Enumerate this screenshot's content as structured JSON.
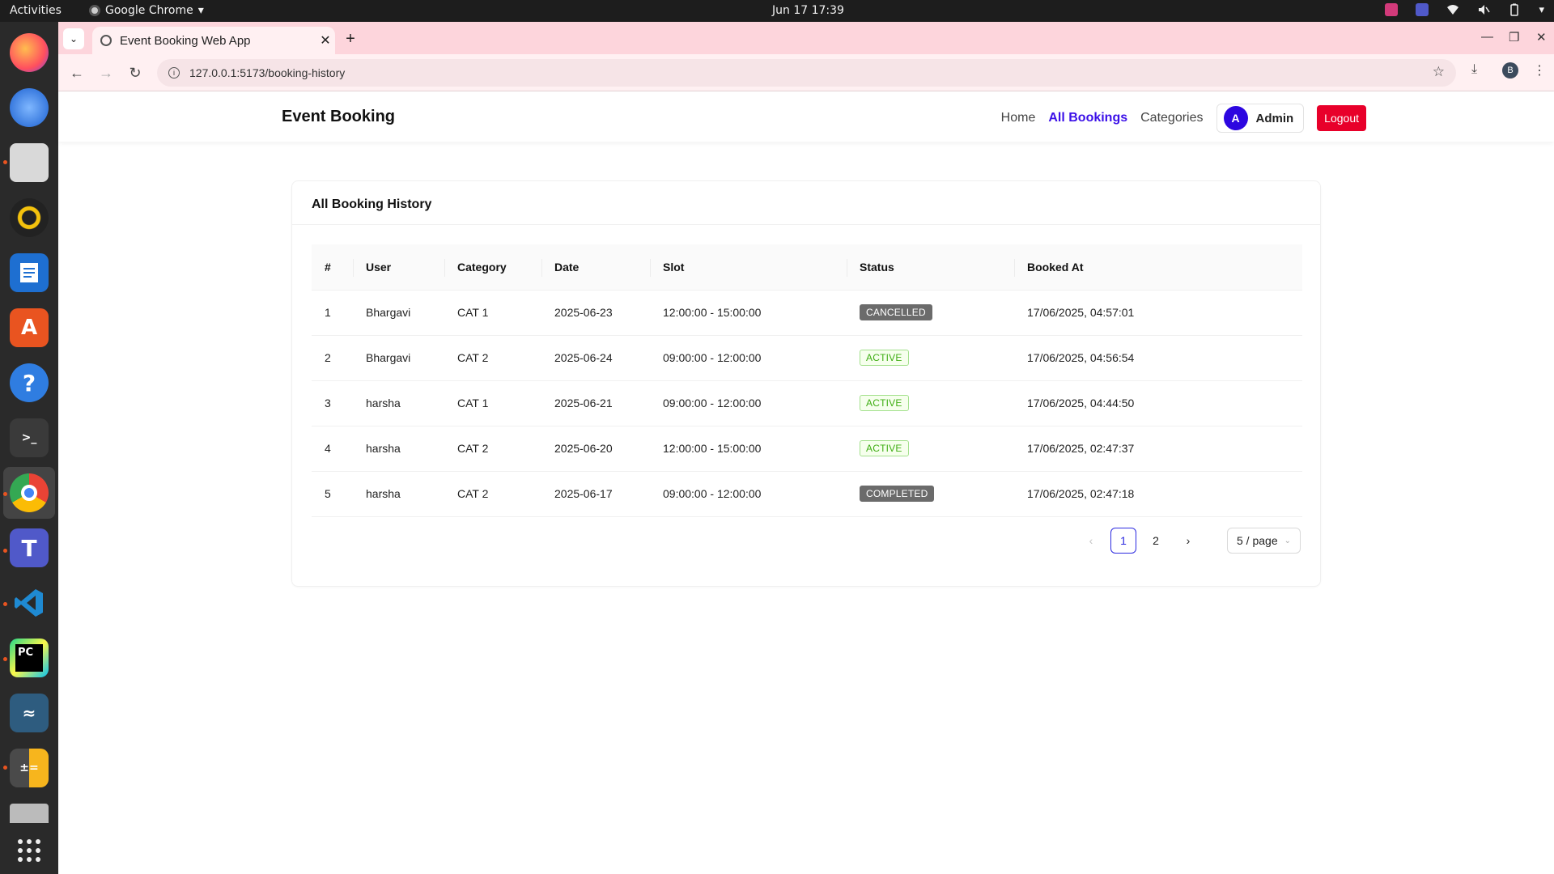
{
  "system": {
    "activities": "Activities",
    "app_name": "Google Chrome",
    "clock": "Jun 17  17:39"
  },
  "browser": {
    "tab_title": "Event Booking Web App",
    "url": "127.0.0.1:5173/booking-history",
    "profile_initial": "B"
  },
  "header": {
    "brand": "Event Booking",
    "nav": [
      {
        "label": "Home",
        "active": false
      },
      {
        "label": "All Bookings",
        "active": true
      },
      {
        "label": "Categories",
        "active": false
      }
    ],
    "user": {
      "initial": "A",
      "name": "Admin"
    },
    "logout_label": "Logout"
  },
  "card": {
    "title": "All Booking History",
    "columns": [
      "#",
      "User",
      "Category",
      "Date",
      "Slot",
      "Status",
      "Booked At"
    ],
    "rows": [
      {
        "num": "1",
        "user": "Bhargavi",
        "category": "CAT 1",
        "date": "2025-06-23",
        "slot": "12:00:00 - 15:00:00",
        "status": "CANCELLED",
        "booked_at": "17/06/2025, 04:57:01"
      },
      {
        "num": "2",
        "user": "Bhargavi",
        "category": "CAT 2",
        "date": "2025-06-24",
        "slot": "09:00:00 - 12:00:00",
        "status": "ACTIVE",
        "booked_at": "17/06/2025, 04:56:54"
      },
      {
        "num": "3",
        "user": "harsha",
        "category": "CAT 1",
        "date": "2025-06-21",
        "slot": "09:00:00 - 12:00:00",
        "status": "ACTIVE",
        "booked_at": "17/06/2025, 04:44:50"
      },
      {
        "num": "4",
        "user": "harsha",
        "category": "CAT 2",
        "date": "2025-06-20",
        "slot": "12:00:00 - 15:00:00",
        "status": "ACTIVE",
        "booked_at": "17/06/2025, 02:47:37"
      },
      {
        "num": "5",
        "user": "harsha",
        "category": "CAT 2",
        "date": "2025-06-17",
        "slot": "09:00:00 - 12:00:00",
        "status": "COMPLETED",
        "booked_at": "17/06/2025, 02:47:18"
      }
    ],
    "pagination": {
      "pages": [
        "1",
        "2"
      ],
      "current": "1",
      "page_size": "5 / page"
    }
  },
  "colors": {
    "accent": "#3b10e8",
    "logout": "#e8002a",
    "active_badge": "#3fae14",
    "neutral_badge": "#6b6b6b"
  }
}
